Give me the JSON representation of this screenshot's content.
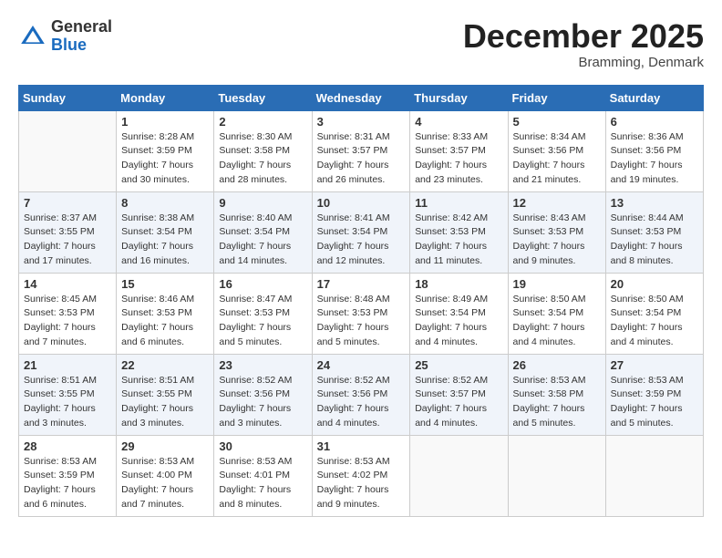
{
  "logo": {
    "general": "General",
    "blue": "Blue"
  },
  "header": {
    "month": "December 2025",
    "location": "Bramming, Denmark"
  },
  "weekdays": [
    "Sunday",
    "Monday",
    "Tuesday",
    "Wednesday",
    "Thursday",
    "Friday",
    "Saturday"
  ],
  "weeks": [
    [
      {
        "day": null
      },
      {
        "day": 1,
        "sunrise": "8:28 AM",
        "sunset": "3:59 PM",
        "daylight": "7 hours and 30 minutes."
      },
      {
        "day": 2,
        "sunrise": "8:30 AM",
        "sunset": "3:58 PM",
        "daylight": "7 hours and 28 minutes."
      },
      {
        "day": 3,
        "sunrise": "8:31 AM",
        "sunset": "3:57 PM",
        "daylight": "7 hours and 26 minutes."
      },
      {
        "day": 4,
        "sunrise": "8:33 AM",
        "sunset": "3:57 PM",
        "daylight": "7 hours and 23 minutes."
      },
      {
        "day": 5,
        "sunrise": "8:34 AM",
        "sunset": "3:56 PM",
        "daylight": "7 hours and 21 minutes."
      },
      {
        "day": 6,
        "sunrise": "8:36 AM",
        "sunset": "3:56 PM",
        "daylight": "7 hours and 19 minutes."
      }
    ],
    [
      {
        "day": 7,
        "sunrise": "8:37 AM",
        "sunset": "3:55 PM",
        "daylight": "7 hours and 17 minutes."
      },
      {
        "day": 8,
        "sunrise": "8:38 AM",
        "sunset": "3:54 PM",
        "daylight": "7 hours and 16 minutes."
      },
      {
        "day": 9,
        "sunrise": "8:40 AM",
        "sunset": "3:54 PM",
        "daylight": "7 hours and 14 minutes."
      },
      {
        "day": 10,
        "sunrise": "8:41 AM",
        "sunset": "3:54 PM",
        "daylight": "7 hours and 12 minutes."
      },
      {
        "day": 11,
        "sunrise": "8:42 AM",
        "sunset": "3:53 PM",
        "daylight": "7 hours and 11 minutes."
      },
      {
        "day": 12,
        "sunrise": "8:43 AM",
        "sunset": "3:53 PM",
        "daylight": "7 hours and 9 minutes."
      },
      {
        "day": 13,
        "sunrise": "8:44 AM",
        "sunset": "3:53 PM",
        "daylight": "7 hours and 8 minutes."
      }
    ],
    [
      {
        "day": 14,
        "sunrise": "8:45 AM",
        "sunset": "3:53 PM",
        "daylight": "7 hours and 7 minutes."
      },
      {
        "day": 15,
        "sunrise": "8:46 AM",
        "sunset": "3:53 PM",
        "daylight": "7 hours and 6 minutes."
      },
      {
        "day": 16,
        "sunrise": "8:47 AM",
        "sunset": "3:53 PM",
        "daylight": "7 hours and 5 minutes."
      },
      {
        "day": 17,
        "sunrise": "8:48 AM",
        "sunset": "3:53 PM",
        "daylight": "7 hours and 5 minutes."
      },
      {
        "day": 18,
        "sunrise": "8:49 AM",
        "sunset": "3:54 PM",
        "daylight": "7 hours and 4 minutes."
      },
      {
        "day": 19,
        "sunrise": "8:50 AM",
        "sunset": "3:54 PM",
        "daylight": "7 hours and 4 minutes."
      },
      {
        "day": 20,
        "sunrise": "8:50 AM",
        "sunset": "3:54 PM",
        "daylight": "7 hours and 4 minutes."
      }
    ],
    [
      {
        "day": 21,
        "sunrise": "8:51 AM",
        "sunset": "3:55 PM",
        "daylight": "7 hours and 3 minutes."
      },
      {
        "day": 22,
        "sunrise": "8:51 AM",
        "sunset": "3:55 PM",
        "daylight": "7 hours and 3 minutes."
      },
      {
        "day": 23,
        "sunrise": "8:52 AM",
        "sunset": "3:56 PM",
        "daylight": "7 hours and 3 minutes."
      },
      {
        "day": 24,
        "sunrise": "8:52 AM",
        "sunset": "3:56 PM",
        "daylight": "7 hours and 4 minutes."
      },
      {
        "day": 25,
        "sunrise": "8:52 AM",
        "sunset": "3:57 PM",
        "daylight": "7 hours and 4 minutes."
      },
      {
        "day": 26,
        "sunrise": "8:53 AM",
        "sunset": "3:58 PM",
        "daylight": "7 hours and 5 minutes."
      },
      {
        "day": 27,
        "sunrise": "8:53 AM",
        "sunset": "3:59 PM",
        "daylight": "7 hours and 5 minutes."
      }
    ],
    [
      {
        "day": 28,
        "sunrise": "8:53 AM",
        "sunset": "3:59 PM",
        "daylight": "7 hours and 6 minutes."
      },
      {
        "day": 29,
        "sunrise": "8:53 AM",
        "sunset": "4:00 PM",
        "daylight": "7 hours and 7 minutes."
      },
      {
        "day": 30,
        "sunrise": "8:53 AM",
        "sunset": "4:01 PM",
        "daylight": "7 hours and 8 minutes."
      },
      {
        "day": 31,
        "sunrise": "8:53 AM",
        "sunset": "4:02 PM",
        "daylight": "7 hours and 9 minutes."
      },
      {
        "day": null
      },
      {
        "day": null
      },
      {
        "day": null
      }
    ]
  ]
}
